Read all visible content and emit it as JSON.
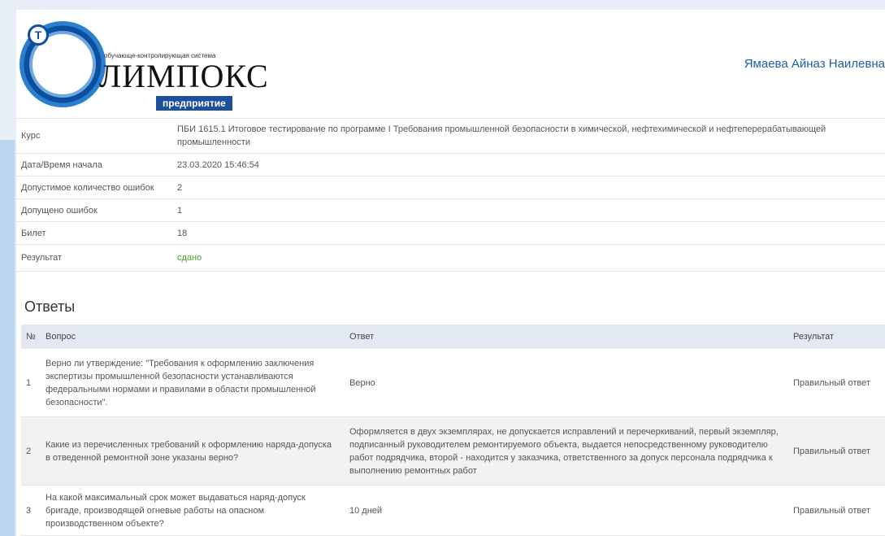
{
  "header": {
    "logo": {
      "badge": "T",
      "tagline": "обучающе-контролирующая система",
      "name": "ЛИМПОКС",
      "subtitle": "предприятие"
    },
    "user_name": "Ямаева Айназ Наилевна"
  },
  "info": {
    "course": {
      "label": "Курс",
      "value": "ПБИ 1615.1 Итоговое тестирование по программе I Требования промышленной безопасности в химической, нефтехимической и нефтеперерабатывающей промышленности"
    },
    "start": {
      "label": "Дата/Время начала",
      "value": "23.03.2020 15:46:54"
    },
    "allowed_errors": {
      "label": "Допустимое количество ошибок",
      "value": "2"
    },
    "errors": {
      "label": "Допущено ошибок",
      "value": "1"
    },
    "ticket": {
      "label": "Билет",
      "value": "18"
    },
    "result": {
      "label": "Результат",
      "value": "сдано"
    }
  },
  "answers": {
    "title": "Ответы",
    "columns": {
      "num": "№",
      "question": "Вопрос",
      "answer": "Ответ",
      "result": "Результат"
    },
    "rows": [
      {
        "num": "1",
        "question": "Верно ли утверждение: \"Требования к оформлению заключения экспертизы промышленной безопасности устанавливаются федеральными нормами и правилами в области промышленной безопасности\".",
        "answer": "Верно",
        "result": "Правильный ответ"
      },
      {
        "num": "2",
        "question": "Какие из перечисленных требований к оформлению наряда-допуска в отведенной ремонтной зоне указаны верно?",
        "answer": "Оформляется в двух экземплярах, не допускается исправлений и перечеркиваний, первый экземпляр, подписанный руководителем ремонтируемого объекта, выдается непосредственному руководителю работ подрядчика, второй - находится у заказчика, ответственного за допуск персонала подрядчика к выполнению ремонтных работ",
        "result": "Правильный ответ"
      },
      {
        "num": "3",
        "question": "На какой максимальный срок может выдаваться наряд-допуск бригаде, производящей огневые работы на опасном производственном объекте?",
        "answer": "10 дней",
        "result": "Правильный ответ"
      }
    ]
  },
  "colors": {
    "accent": "#1f5fa8",
    "status_ok": "#48a230",
    "table_header_bg": "#e3e9f3",
    "frame": "#bcd4ee"
  }
}
